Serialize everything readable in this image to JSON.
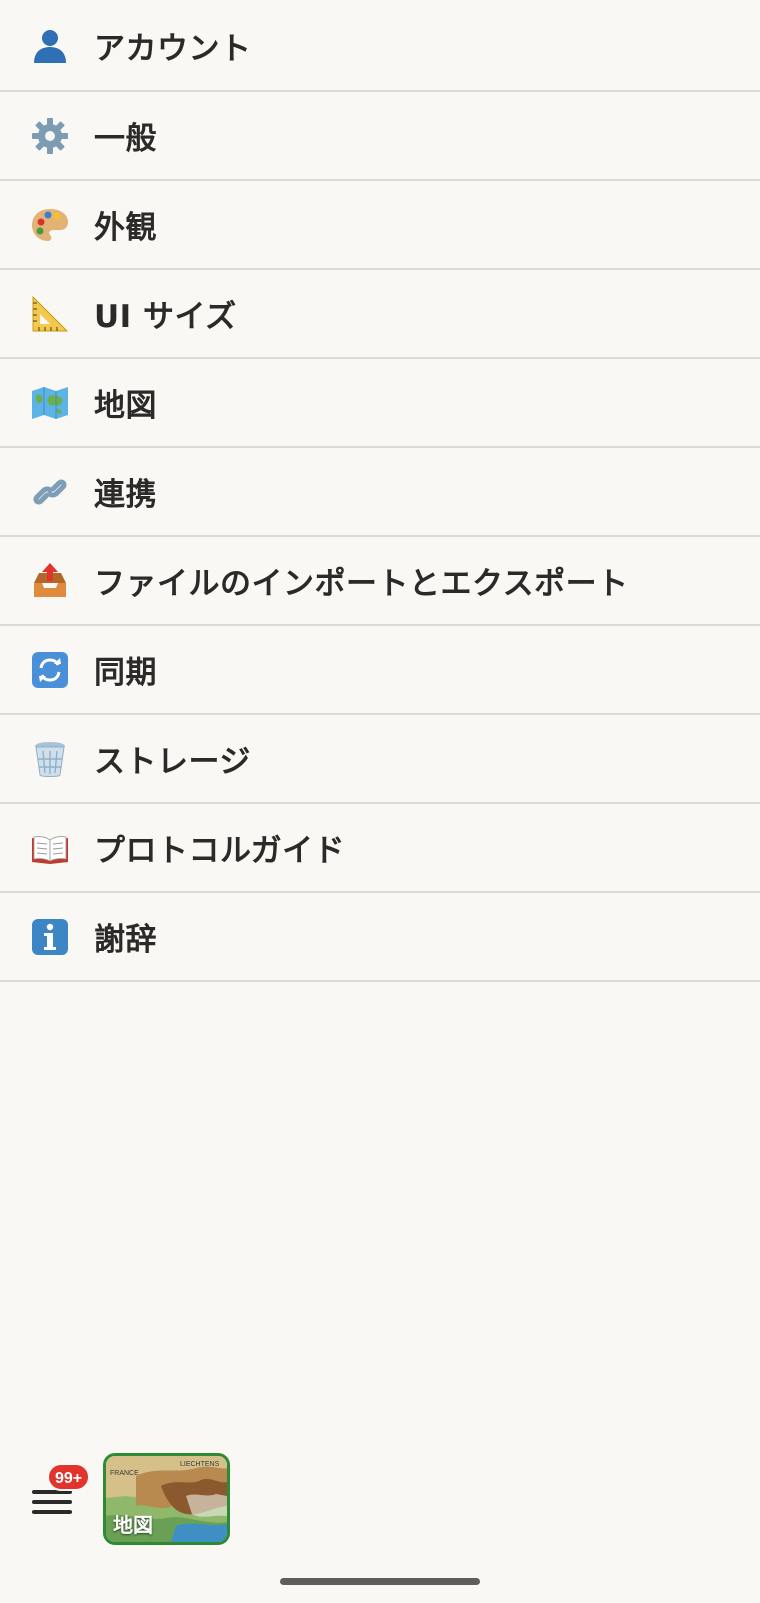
{
  "menu": {
    "items": [
      {
        "label": "アカウント",
        "icon": "person-icon"
      },
      {
        "label": "一般",
        "icon": "gear-icon"
      },
      {
        "label": "外観",
        "icon": "palette-icon"
      },
      {
        "label": "UI サイズ",
        "icon": "triangle-ruler-icon"
      },
      {
        "label": "地図",
        "icon": "world-map-icon"
      },
      {
        "label": "連携",
        "icon": "link-icon"
      },
      {
        "label": "ファイルのインポートとエクスポート",
        "icon": "outbox-tray-icon"
      },
      {
        "label": "同期",
        "icon": "sync-arrows-icon"
      },
      {
        "label": "ストレージ",
        "icon": "wastebasket-icon"
      },
      {
        "label": "プロトコルガイド",
        "icon": "open-book-icon"
      },
      {
        "label": "謝辞",
        "icon": "information-icon"
      }
    ]
  },
  "bottom_bar": {
    "menu_icon": "hamburger-menu-icon",
    "badge_count": "99+",
    "map_thumbnail": {
      "label": "地図",
      "tiny_labels": [
        "FRANCE",
        "LIECHTENS"
      ]
    },
    "badge_color": "#e0342c",
    "thumbnail_border_color": "#2f8a35"
  }
}
